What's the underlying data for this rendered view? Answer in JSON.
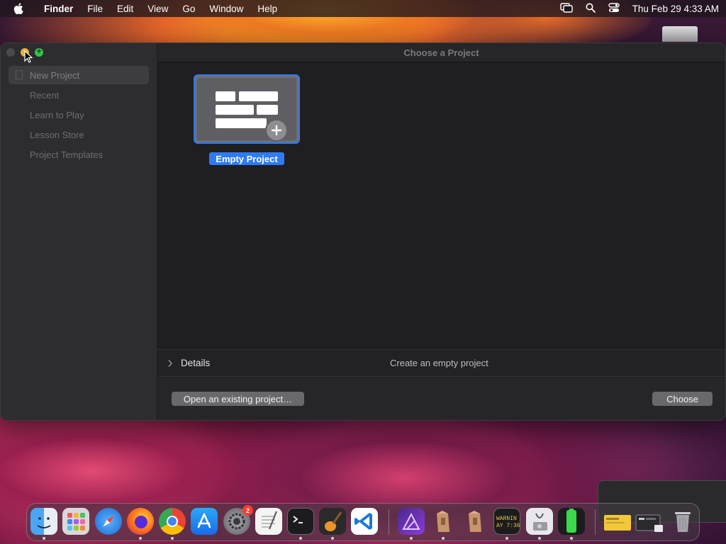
{
  "menubar": {
    "app_name": "Finder",
    "items": [
      "File",
      "Edit",
      "View",
      "Go",
      "Window",
      "Help"
    ],
    "clock": "Thu Feb 29  4:33 AM"
  },
  "window": {
    "title": "Choose a Project",
    "sidebar": {
      "items": [
        {
          "label": "New Project",
          "active": true
        },
        {
          "label": "Recent",
          "active": false
        },
        {
          "label": "Learn to Play",
          "active": false
        },
        {
          "label": "Lesson Store",
          "active": false
        },
        {
          "label": "Project Templates",
          "active": false
        }
      ]
    },
    "project": {
      "label": "Empty Project"
    },
    "details": {
      "label": "Details",
      "description": "Create an empty project"
    },
    "footer": {
      "open_label": "Open an existing project…",
      "choose_label": "Choose"
    }
  },
  "dock": {
    "items": [
      {
        "name": "finder",
        "running": true
      },
      {
        "name": "launchpad",
        "running": false
      },
      {
        "name": "safari",
        "running": false
      },
      {
        "name": "firefox",
        "running": true
      },
      {
        "name": "chrome",
        "running": true
      },
      {
        "name": "app-store",
        "running": false
      },
      {
        "name": "system-settings",
        "running": false,
        "badge": "2"
      },
      {
        "name": "textedit",
        "running": false
      },
      {
        "name": "terminal",
        "running": true
      },
      {
        "name": "garageband",
        "running": true
      },
      {
        "name": "vscode",
        "running": false
      },
      {
        "name": "affinity",
        "running": true
      },
      {
        "name": "archive-utility",
        "running": true
      },
      {
        "name": "archive-utility-2",
        "running": false
      },
      {
        "name": "console",
        "running": true
      },
      {
        "name": "disk-utility",
        "running": true
      },
      {
        "name": "battery-app",
        "running": true
      },
      {
        "name": "downloads-stack",
        "running": false
      },
      {
        "name": "recent-stack",
        "running": false
      },
      {
        "name": "trash",
        "running": false
      }
    ],
    "console_text": "WARNIN\nAY 7:36"
  },
  "colors": {
    "accent": "#2f7bf5",
    "window_bg": "#262628",
    "sidebar_bg": "#2d2d2f",
    "traffic_min": "#e8b23a",
    "traffic_zoom": "#36c04a"
  }
}
